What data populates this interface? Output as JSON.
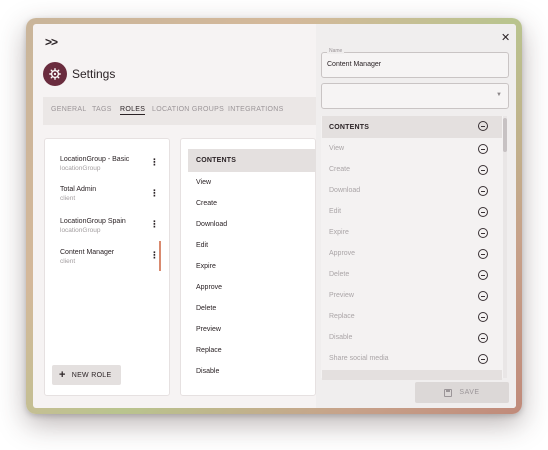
{
  "header": {
    "expand_icon": ">>",
    "title": "Settings"
  },
  "tabs": [
    "GENERAL",
    "TAGS",
    "ROLES",
    "LOCATION GROUPS",
    "INTEGRATIONS"
  ],
  "active_tab": "ROLES",
  "roles": [
    {
      "name": "LocationGroup - Basic",
      "type": "locationGroup"
    },
    {
      "name": "Total Admin",
      "type": "client"
    },
    {
      "name": "LocationGroup Spain",
      "type": "locationGroup"
    },
    {
      "name": "Content Manager",
      "type": "client"
    }
  ],
  "new_role_label": "NEW ROLE",
  "permissions_panel": {
    "header": "CONTENTS",
    "items": [
      "View",
      "Create",
      "Download",
      "Edit",
      "Expire",
      "Approve",
      "Delete",
      "Preview",
      "Replace",
      "Disable"
    ]
  },
  "drawer": {
    "close_icon": "✕",
    "name_label": "Name",
    "name_value": "Content Manager",
    "select_placeholder": "",
    "list_header": "CONTENTS",
    "list_items": [
      "View",
      "Create",
      "Download",
      "Edit",
      "Expire",
      "Approve",
      "Delete",
      "Preview",
      "Replace",
      "Disable",
      "Share social media"
    ],
    "save_label": "SAVE"
  },
  "colors": {
    "accent": "#6a2c3e",
    "active_indicator": "#d98a6f"
  }
}
